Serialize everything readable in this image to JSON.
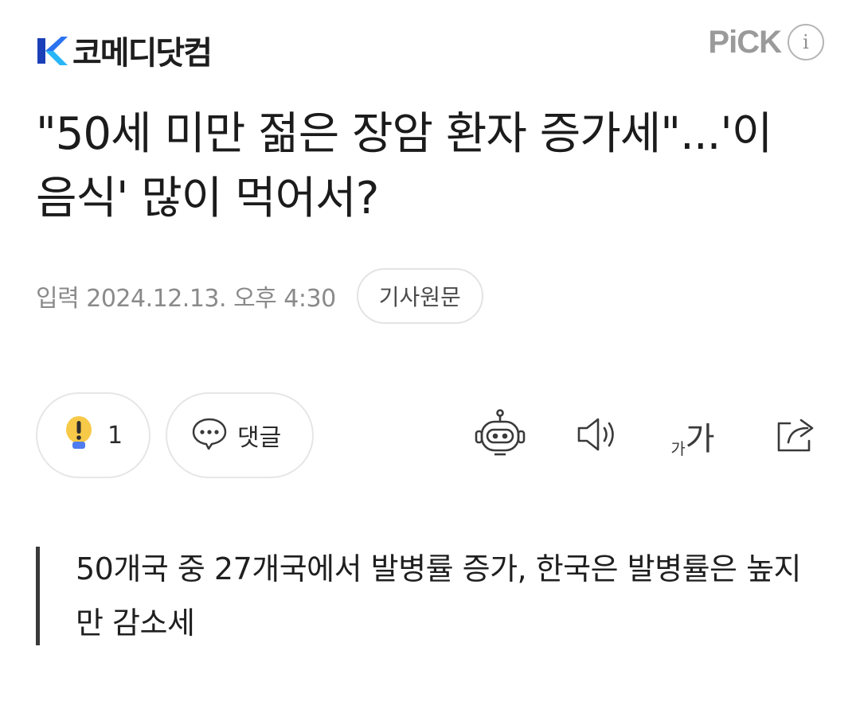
{
  "header": {
    "brand_name": "코메디닷컴",
    "pick_label": "PiCK",
    "info_label": "i",
    "brand_color": "#2a73f0"
  },
  "article": {
    "title": "\"50세 미만 젊은 장암 환자 증가세\"...'이 음식' 많이 먹어서?",
    "published": "입력 2024.12.13. 오후 4:30",
    "source_button": "기사원문",
    "subtitle": "50개국 중 27개국에서 발병률 증가, 한국은 발병률은 높지만 감소세"
  },
  "actions": {
    "reaction_icon": "exclamation-bulb-icon",
    "reaction_count": "1",
    "comment_label": "댓글",
    "tools": [
      "summary-bot-icon",
      "speaker-icon",
      "font-size-icon",
      "share-icon"
    ],
    "font_small": "가",
    "font_big": "가"
  }
}
